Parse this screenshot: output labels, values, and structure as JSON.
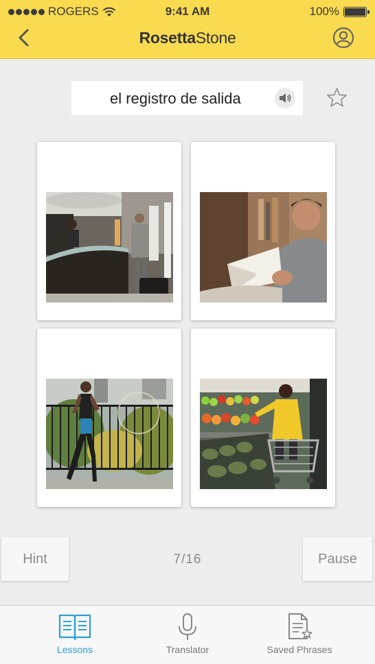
{
  "status_bar": {
    "carrier": "ROGERS",
    "time": "9:41 AM",
    "battery_percent": "100%"
  },
  "nav": {
    "brand_bold": "Rosetta",
    "brand_light": "Stone",
    "back_icon": "chevron-left-icon",
    "profile_icon": "user-circle-icon",
    "accent_color": "#fada4f"
  },
  "prompt": {
    "phrase": "el registro de salida",
    "speaker_icon": "speaker-icon",
    "favorite_icon": "star-outline-icon"
  },
  "choices": [
    {
      "subject": "hotel-checkout-photo"
    },
    {
      "subject": "man-reading-book-photo"
    },
    {
      "subject": "woman-jogging-photo"
    },
    {
      "subject": "woman-grocery-shopping-photo"
    }
  ],
  "controls": {
    "hint_label": "Hint",
    "progress": "7/16",
    "pause_label": "Pause"
  },
  "tabbar": {
    "active_color": "#2a9fd6",
    "tabs": [
      {
        "label": "Lessons",
        "icon": "open-book-icon",
        "active": true
      },
      {
        "label": "Translator",
        "icon": "microphone-icon",
        "active": false
      },
      {
        "label": "Saved Phrases",
        "icon": "saved-document-star-icon",
        "active": false
      }
    ]
  }
}
